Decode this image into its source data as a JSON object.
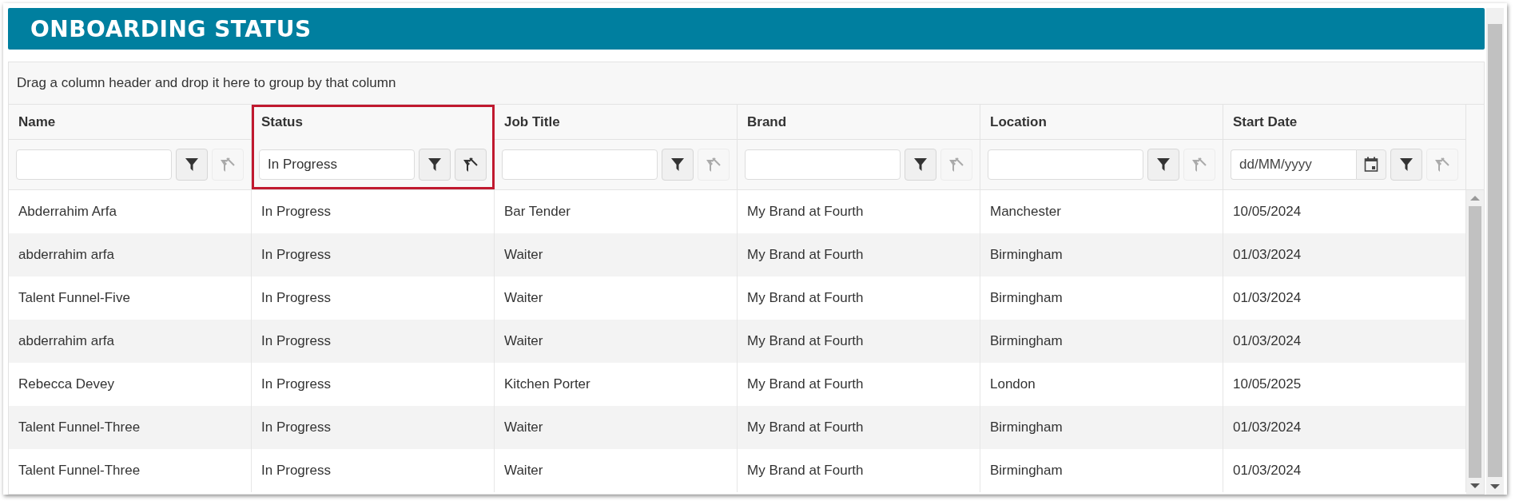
{
  "panel": {
    "title": "ONBOARDING STATUS"
  },
  "group_bar": {
    "text": "Drag a column header and drop it here to group by that column"
  },
  "columns": [
    {
      "label": "Name",
      "kind": "text",
      "highlighted": false,
      "clear_enabled": false
    },
    {
      "label": "Status",
      "kind": "text",
      "value": "In Progress",
      "highlighted": true,
      "clear_enabled": true
    },
    {
      "label": "Job Title",
      "kind": "text",
      "highlighted": false,
      "clear_enabled": false
    },
    {
      "label": "Brand",
      "kind": "text",
      "highlighted": false,
      "clear_enabled": false
    },
    {
      "label": "Location",
      "kind": "text",
      "highlighted": false,
      "clear_enabled": false
    },
    {
      "label": "Start Date",
      "kind": "date",
      "placeholder": "dd/MM/yyyy",
      "highlighted": false,
      "clear_enabled": false
    }
  ],
  "rows": [
    {
      "cells": [
        "Abderrahim Arfa",
        "In Progress",
        "Bar Tender",
        "My Brand at Fourth",
        "Manchester",
        "10/05/2024"
      ]
    },
    {
      "cells": [
        "abderrahim arfa",
        "In Progress",
        "Waiter",
        "My Brand at Fourth",
        "Birmingham",
        "01/03/2024"
      ]
    },
    {
      "cells": [
        "Talent Funnel-Five",
        "In Progress",
        "Waiter",
        "My Brand at Fourth",
        "Birmingham",
        "01/03/2024"
      ]
    },
    {
      "cells": [
        "abderrahim arfa",
        "In Progress",
        "Waiter",
        "My Brand at Fourth",
        "Birmingham",
        "01/03/2024"
      ]
    },
    {
      "cells": [
        "Rebecca Devey",
        "In Progress",
        "Kitchen Porter",
        "My Brand at Fourth",
        "London",
        "10/05/2025"
      ]
    },
    {
      "cells": [
        "Talent Funnel-Three",
        "In Progress",
        "Waiter",
        "My Brand at Fourth",
        "Birmingham",
        "01/03/2024"
      ]
    },
    {
      "cells": [
        "Talent Funnel-Three",
        "In Progress",
        "Waiter",
        "My Brand at Fourth",
        "Birmingham",
        "01/03/2024"
      ]
    }
  ]
}
